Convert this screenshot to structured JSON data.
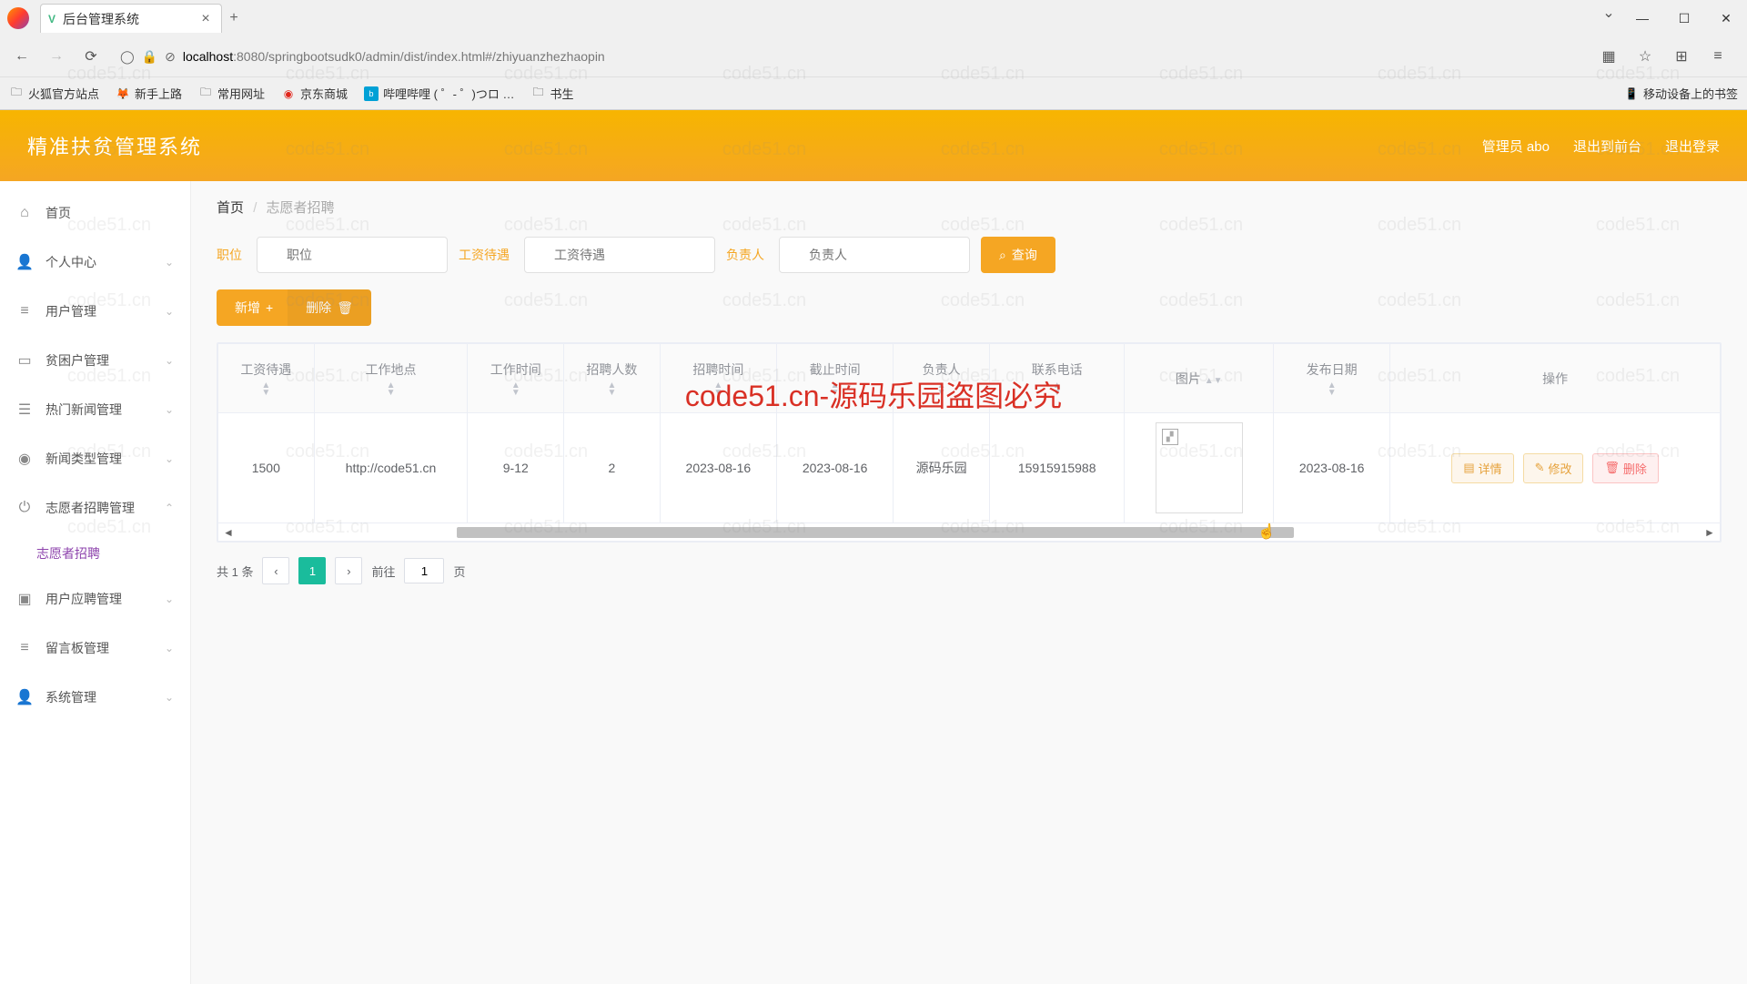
{
  "browser": {
    "tab_title": "后台管理系统",
    "url_host": "localhost",
    "url_port": ":8080",
    "url_path": "/springbootsudk0/admin/dist/index.html#/zhiyuanzhezhaopin",
    "bookmarks": [
      "火狐官方站点",
      "新手上路",
      "常用网址",
      "京东商城",
      "哔哩哔哩 (  ゜- ゜)つロ …",
      "书生"
    ],
    "bookmark_right": "移动设备上的书签"
  },
  "header": {
    "title": "精准扶贫管理系统",
    "user": "管理员 abo",
    "link1": "退出到前台",
    "link2": "退出登录"
  },
  "sidebar": {
    "items": [
      {
        "label": "首页",
        "icon": "⌂"
      },
      {
        "label": "个人中心",
        "icon": "👤",
        "chev": "⌄"
      },
      {
        "label": "用户管理",
        "icon": "≡",
        "chev": "⌄"
      },
      {
        "label": "贫困户管理",
        "icon": "▭",
        "chev": "⌄"
      },
      {
        "label": "热门新闻管理",
        "icon": "☰",
        "chev": "⌄"
      },
      {
        "label": "新闻类型管理",
        "icon": "◉",
        "chev": "⌄"
      },
      {
        "label": "志愿者招聘管理",
        "icon": "⏻",
        "chev": "⌃",
        "expanded": true
      },
      {
        "label": "用户应聘管理",
        "icon": "▣",
        "chev": "⌄"
      },
      {
        "label": "留言板管理",
        "icon": "≡",
        "chev": "⌄"
      },
      {
        "label": "系统管理",
        "icon": "👤",
        "chev": "⌄"
      }
    ],
    "submenu_active": "志愿者招聘"
  },
  "breadcrumb": {
    "home": "首页",
    "current": "志愿者招聘"
  },
  "filters": {
    "label1": "职位",
    "ph1": "职位",
    "label2": "工资待遇",
    "ph2": "工资待遇",
    "label3": "负责人",
    "ph3": "负责人",
    "search_btn": "查询"
  },
  "actions": {
    "add": "新增",
    "del": "删除"
  },
  "table": {
    "headers": [
      "工资待遇",
      "工作地点",
      "工作时间",
      "招聘人数",
      "招聘时间",
      "截止时间",
      "负责人",
      "联系电话",
      "图片",
      "发布日期",
      "操作"
    ],
    "row": {
      "salary": "1500",
      "place": "http://code51.cn",
      "worktime": "9-12",
      "count": "2",
      "start": "2023-08-16",
      "end": "2023-08-16",
      "owner": "源码乐园",
      "phone": "15915915988",
      "pubdate": "2023-08-16"
    },
    "ops": {
      "detail": "详情",
      "edit": "修改",
      "del": "删除"
    }
  },
  "pagination": {
    "total": "共 1 条",
    "goto_pre": "前往",
    "goto_post": "页",
    "page": "1"
  },
  "watermark": {
    "text": "code51.cn",
    "center": "code51.cn-源码乐园盗图必究"
  }
}
